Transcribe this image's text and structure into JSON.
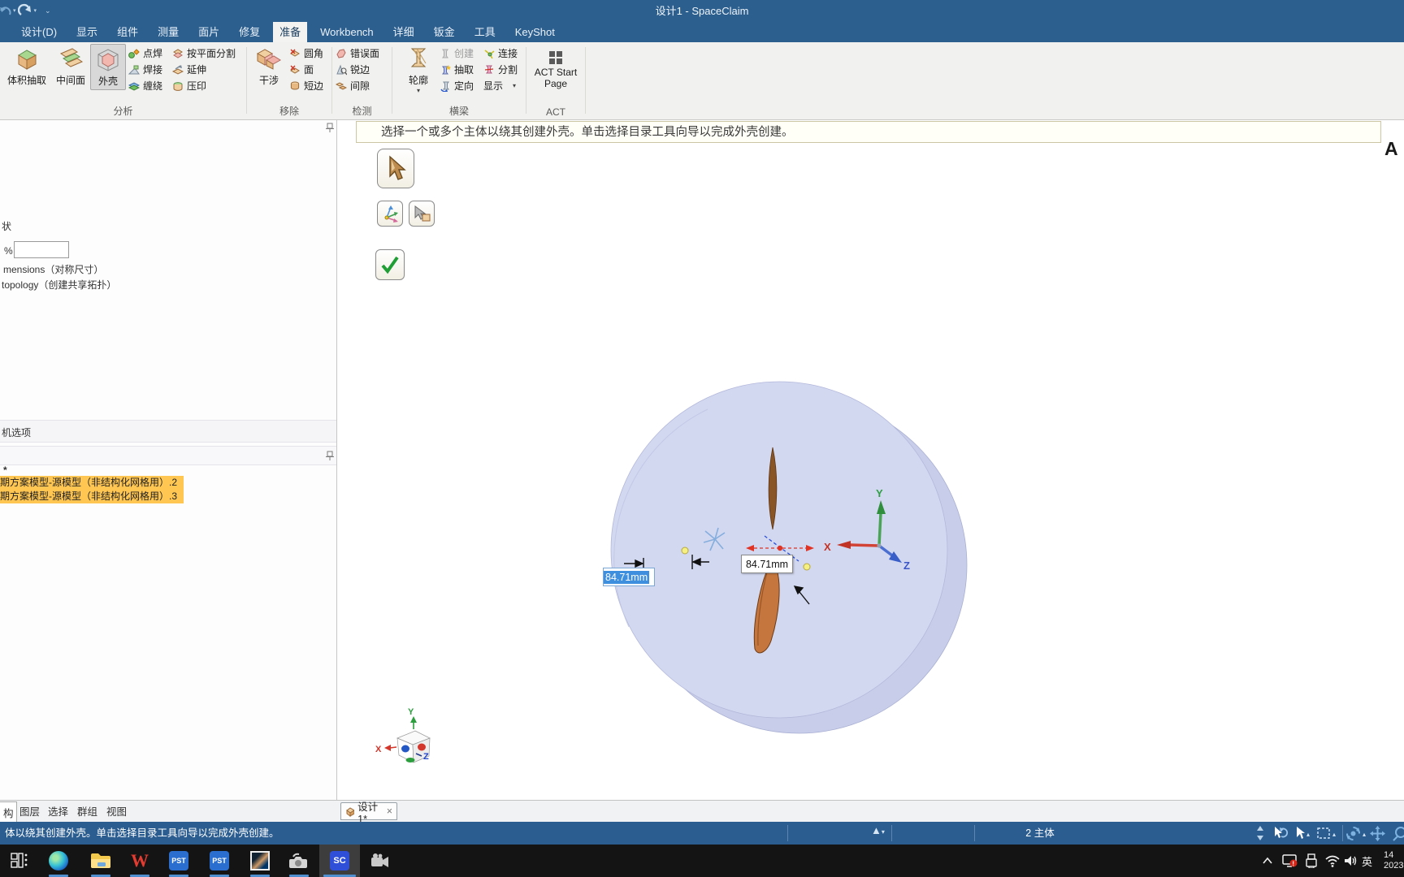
{
  "app": {
    "title": "设计1 - SpaceClaim"
  },
  "menu": {
    "tabs": [
      "设计(D)",
      "显示",
      "组件",
      "测量",
      "面片",
      "修复",
      "准备",
      "Workbench",
      "详细",
      "钣金",
      "工具",
      "KeyShot"
    ],
    "active_tab": "准备"
  },
  "ribbon": {
    "analysis": {
      "label": "分析",
      "volume_extract": "体积抽取",
      "midsurface": "中间面",
      "shell": "外壳",
      "spot_weld": "点焊",
      "weld": "焊接",
      "wrap": "缠绕",
      "split_by_plane": "按平面分割",
      "extend": "延伸",
      "imprint": "压印"
    },
    "remove": {
      "label": "移除",
      "interference": "干涉",
      "fillet": "圆角",
      "face": "面",
      "short_edge": "短边"
    },
    "detect": {
      "label": "检测",
      "error_face": "错误面",
      "sharp_edge": "锐边",
      "gap": "间隙"
    },
    "beam": {
      "label": "横梁",
      "profile": "轮廓",
      "create": "创建",
      "extract": "抽取",
      "orient": "定向",
      "connect": "连接",
      "split": "分割",
      "display": "显示"
    },
    "act": {
      "label": "ACT",
      "start_page": "ACT Start Page"
    }
  },
  "left_panel": {
    "clipped_shape_text": "状",
    "clipped_percent": "%",
    "option_symmetric": "mensions（对称尺寸）",
    "option_topology": "topology（创建共享拓扑）",
    "section_header": "机选项",
    "star": "*",
    "rows": [
      "期方案模型-源模型（非结构化网格用）.2",
      "期方案模型-源模型（非结构化网格用）.3"
    ],
    "tabs": {
      "structure": "构",
      "layers": "图层",
      "selection": "选择",
      "groups": "群组",
      "views": "视图"
    }
  },
  "viewport": {
    "prompt": "选择一个或多个主体以绕其创建外壳。单击选择目录工具向导以完成外壳创建。",
    "corner_letter": "A",
    "dim_selected": "84.71mm",
    "dim_tooltip": "84.71mm",
    "triad": {
      "x": "X",
      "y": "Y",
      "z": "Z"
    }
  },
  "doc_tab": {
    "label": "设计1*",
    "close": "×"
  },
  "status_bar": {
    "message": "体以绕其创建外壳。单击选择目录工具向导以完成外壳创建。",
    "selection_info": "2 主体"
  },
  "taskbar": {
    "pst_label": "PST",
    "sc_label": "SC",
    "ime": "英",
    "time": "14",
    "date": "2023"
  },
  "colors": {
    "titlebar": "#2d5f8e",
    "statusbar": "#2b5d90",
    "highlight_row": "#ffc652",
    "selection_blue": "#3f8fdf",
    "cylinder": "#d3d8f1",
    "blade": "#c4763e"
  }
}
